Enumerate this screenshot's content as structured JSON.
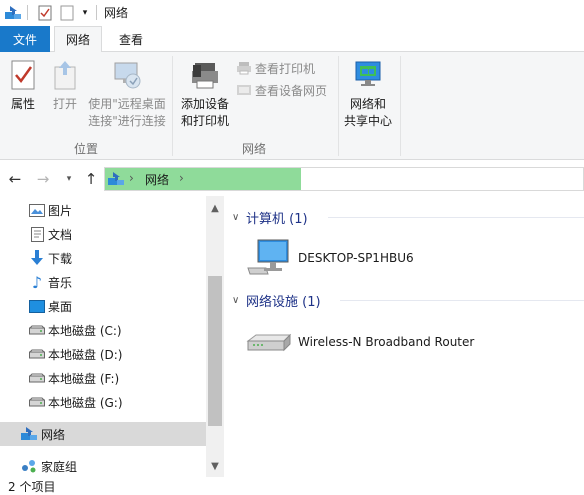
{
  "window": {
    "title": "网络"
  },
  "qat": {
    "icons": [
      "network-icon",
      "properties-icon",
      "new-folder-icon",
      "customize-icon"
    ]
  },
  "tabs": [
    {
      "label": "文件"
    },
    {
      "label": "网络"
    },
    {
      "label": "查看"
    }
  ],
  "ribbon": {
    "properties": "属性",
    "open": "打开",
    "map_drive_line1": "使用\"远程桌面",
    "map_drive_line2": "连接\"进行连接",
    "add_device_line1": "添加设备",
    "add_device_line2": "和打印机",
    "view_printers": "查看打印机",
    "view_device_web": "查看设备网页",
    "network_center_line1": "网络和",
    "network_center_line2": "共享中心",
    "group_location": "位置",
    "group_network": "网络"
  },
  "address": {
    "crumbs": [
      "网络"
    ],
    "chevron": "›"
  },
  "navpane": {
    "items": [
      {
        "label": "图片",
        "icon": "pictures-icon"
      },
      {
        "label": "文档",
        "icon": "documents-icon"
      },
      {
        "label": "下载",
        "icon": "downloads-icon"
      },
      {
        "label": "音乐",
        "icon": "music-icon"
      },
      {
        "label": "桌面",
        "icon": "desktop-icon"
      },
      {
        "label": "本地磁盘 (C:)",
        "icon": "drive-icon"
      },
      {
        "label": "本地磁盘 (D:)",
        "icon": "drive-icon"
      },
      {
        "label": "本地磁盘 (F:)",
        "icon": "drive-icon"
      },
      {
        "label": "本地磁盘 (G:)",
        "icon": "drive-icon"
      },
      {
        "label": "网络",
        "icon": "network-icon"
      },
      {
        "label": "家庭组",
        "icon": "homegroup-icon"
      }
    ]
  },
  "content": {
    "groups": [
      {
        "title": "计算机 (1)",
        "items": [
          {
            "label": "DESKTOP-SP1HBU6",
            "icon": "computer-icon"
          }
        ]
      },
      {
        "title": "网络设施 (1)",
        "items": [
          {
            "label": "Wireless-N Broadband Router",
            "icon": "router-icon"
          }
        ]
      }
    ]
  },
  "status": {
    "count": "2 个项目"
  },
  "colors": {
    "accent": "#1979ca",
    "address_fill": "#8fdb9a",
    "group_title": "#1e3287"
  }
}
